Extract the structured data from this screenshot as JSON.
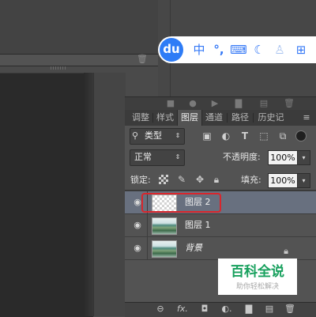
{
  "baidu_toolbar": {
    "logo": "du",
    "items": [
      {
        "name": "chinese-input-icon",
        "glyph": "中"
      },
      {
        "name": "punctuation-icon",
        "glyph": "°,"
      },
      {
        "name": "keyboard-icon",
        "glyph": "⌨"
      },
      {
        "name": "moon-icon",
        "glyph": "☾"
      },
      {
        "name": "user-icon",
        "glyph": "♙"
      },
      {
        "name": "grid-icon",
        "glyph": "⊞"
      }
    ]
  },
  "panel_tabs": [
    {
      "label": "调整",
      "active": false
    },
    {
      "label": "样式",
      "active": false
    },
    {
      "label": "图层",
      "active": true
    },
    {
      "label": "通道",
      "active": false
    },
    {
      "label": "路径",
      "active": false
    },
    {
      "label": "历史记",
      "active": false
    }
  ],
  "panel_menu_glyph": "≡",
  "filter": {
    "search_glyph": "⚲",
    "kind_label": "类型",
    "arrows_glyph": "⇕",
    "icons": [
      {
        "name": "pixel-filter-icon",
        "glyph": "▣"
      },
      {
        "name": "adjustment-filter-icon",
        "glyph": "◐"
      },
      {
        "name": "type-filter-icon",
        "glyph": "T"
      },
      {
        "name": "shape-filter-icon",
        "glyph": "⬚"
      },
      {
        "name": "smart-object-filter-icon",
        "glyph": "⧉"
      }
    ]
  },
  "blend": {
    "mode": "正常",
    "arrows_glyph": "⇕",
    "opacity_label": "不透明度:",
    "opacity_value": "100%",
    "dropdown_glyph": "▾"
  },
  "lock": {
    "label": "锁定:",
    "brush_glyph": "✎",
    "move_glyph": "✥",
    "lock_glyph": "🔒︎",
    "fill_label": "填充:",
    "fill_value": "100%",
    "dropdown_glyph": "▾"
  },
  "layers": [
    {
      "name": "图层 2",
      "selected": true,
      "thumb": "transparent",
      "eye": "◉"
    },
    {
      "name": "图层 1",
      "selected": false,
      "thumb": "photo",
      "eye": "◉"
    },
    {
      "name": "背景",
      "selected": false,
      "thumb": "photo",
      "eye": "◉",
      "background": true
    }
  ],
  "bg_lock_glyph": "🔒︎",
  "top_trash_glyph": "🗑︎",
  "top_bar_icons": [
    "■",
    "●",
    "▶",
    "▇",
    "▤",
    "🗑︎"
  ],
  "bottom_bar_icons": [
    "⊖",
    "fx.",
    "◘",
    "◐.",
    "▇",
    "▤",
    "🗑︎"
  ],
  "watermark": {
    "title": "百科全说",
    "subtitle": "助你轻松解决"
  },
  "colors": {
    "selected_layer_bg": "#68707f",
    "highlight_border": "#d8262c",
    "baidu_blue": "#2e7cf6",
    "watermark_green": "#17a05d"
  }
}
